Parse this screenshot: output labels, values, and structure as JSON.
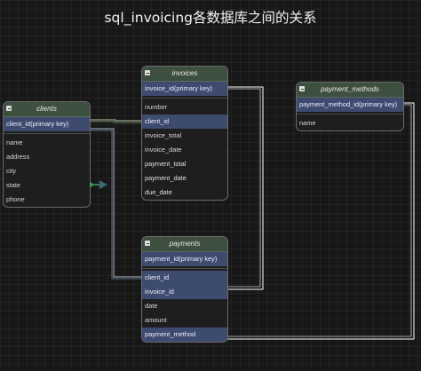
{
  "title": "sql_invoicing各数据库之间的关系",
  "tables": {
    "clients": {
      "name": "clients",
      "primary_key": "client_id(primary key)",
      "columns": [
        "name",
        "address",
        "city",
        "state",
        "phone"
      ]
    },
    "invoices": {
      "name": "invoices",
      "primary_key": "invoice_id(primary key)",
      "columns": [
        "number",
        "client_id",
        "invoice_total",
        "invoice_date",
        "payment_total",
        "payment_date",
        "due_date"
      ]
    },
    "payments": {
      "name": "payments",
      "primary_key": "payment_id(primary key)",
      "columns": [
        "client_id",
        "invoice_id",
        "date",
        "amount",
        "payment_method"
      ]
    },
    "payment_methods": {
      "name": "payment_methods",
      "primary_key": "payment_method_id(primary key)",
      "columns": [
        "name"
      ]
    }
  }
}
